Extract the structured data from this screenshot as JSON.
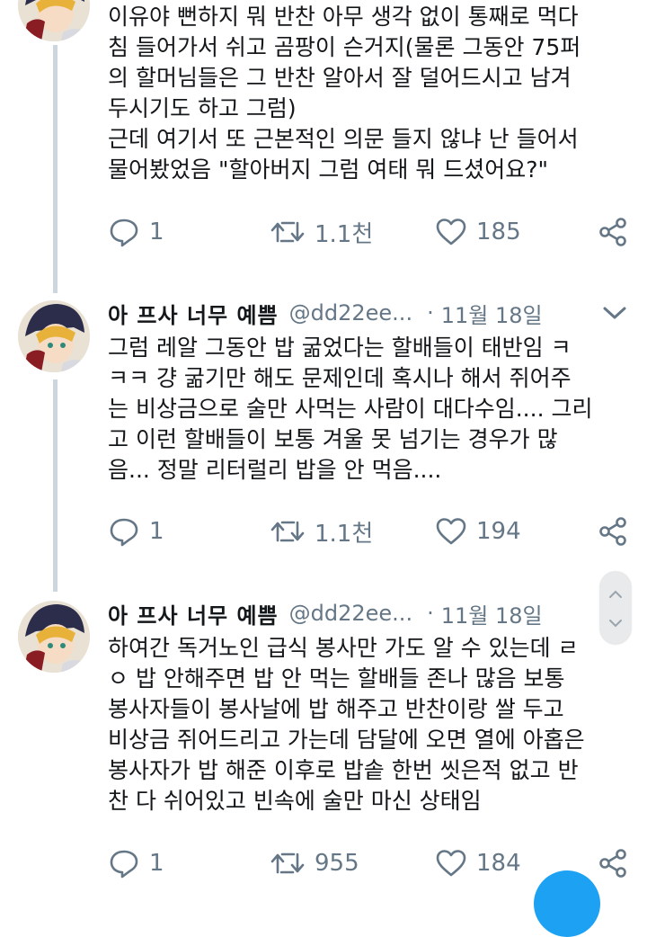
{
  "tweets": [
    {
      "lines": [
        "이유야 뻔하지 뭐 반찬 아무 생각 없이 통째로 먹다",
        "침 들어가서 쉬고 곰팡이 슨거지(물론 그동안 75퍼",
        "의 할머님들은 그 반찬 알아서 잘 덜어드시고 남겨",
        "두시기도 하고 그럼)",
        "근데 여기서 또 근본적인 의문 들지 않냐 난 들어서",
        "물어봤었음 \"할아버지 그럼 여태 뭐 드셨어요?\""
      ],
      "replies": "1",
      "retweets": "1.1천",
      "likes": "185"
    },
    {
      "author": "아 프사 너무 예쁨",
      "handle": "@dd22ee...",
      "dot": "·",
      "date": "11월 18일",
      "lines": [
        "그럼 레알 그동안 밥 굶었다는 할배들이 태반임 ㅋ",
        "ㅋㅋ 걍 굶기만 해도 문제인데 혹시나 해서 쥐어주",
        "는 비상금으로 술만 사먹는 사람이 대다수임.... 그리",
        "고 이런 할배들이 보통 겨울 못 넘기는 경우가 많",
        "음... 정말 리터럴리 밥을 안 먹음...."
      ],
      "replies": "1",
      "retweets": "1.1천",
      "likes": "194"
    },
    {
      "author": "아 프사 너무 예쁨",
      "handle": "@dd22ee...",
      "dot": "·",
      "date": "11월 18일",
      "lines": [
        "하여간 독거노인 급식 봉사만 가도 알 수 있는데 ㄹ",
        "ㅇ 밥 안해주면 밥 안 먹는 할배들 존나 많음 보통",
        "봉사자들이 봉사날에 밥 해주고 반찬이랑 쌀 두고",
        "비상금 쥐어드리고 가는데 담달에 오면 열에 아홉은",
        "봉사자가 밥 해준 이후로 밥솥 한번 씻은적 없고 반",
        "찬 다 쉬어있고 빈속에 술만 마신 상태임"
      ],
      "replies": "1",
      "retweets": "955",
      "likes": "184"
    }
  ],
  "colors": {
    "text": "#14171a",
    "muted": "#657786",
    "thread_line": "#cdd6dd",
    "accent": "#1da1f2"
  },
  "icons": {
    "reply": "reply-icon",
    "retweet": "retweet-icon",
    "like": "heart-icon",
    "share": "share-icon",
    "more": "chevron-down-icon"
  }
}
